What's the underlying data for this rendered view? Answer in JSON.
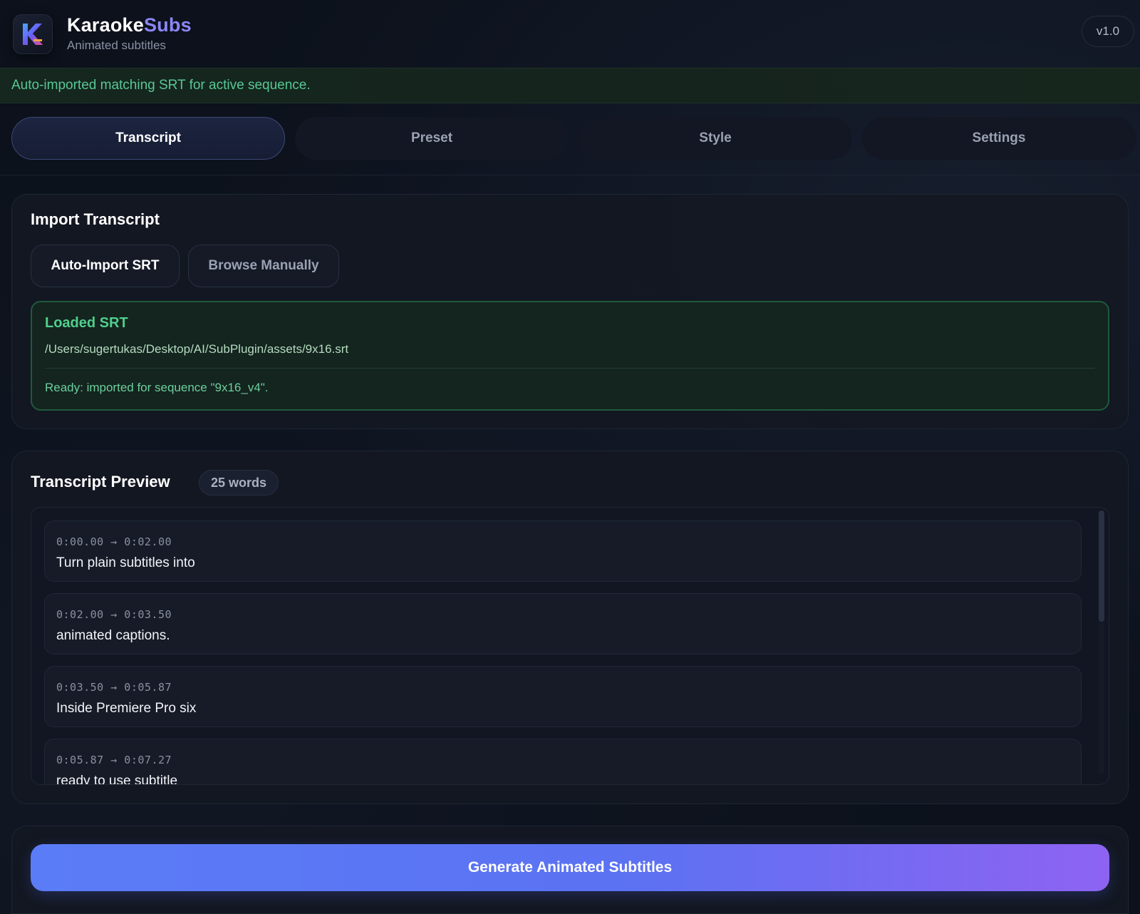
{
  "app": {
    "title_main": "Karaoke",
    "title_accent": "Subs",
    "subtitle": "Animated subtitles",
    "version": "v1.0",
    "logo_letter": "K",
    "colors": {
      "accent": "#8b86f6",
      "success": "#4fd08c",
      "background": "#0c111b"
    }
  },
  "banner": {
    "text": "Auto-imported matching SRT for active sequence."
  },
  "tabs": [
    {
      "label": "Transcript",
      "active": true
    },
    {
      "label": "Preset",
      "active": false
    },
    {
      "label": "Style",
      "active": false
    },
    {
      "label": "Settings",
      "active": false
    }
  ],
  "import_panel": {
    "title": "Import Transcript",
    "auto_import_label": "Auto-Import SRT",
    "browse_label": "Browse Manually",
    "loaded": {
      "title": "Loaded SRT",
      "path": "/Users/sugertukas/Desktop/AI/SubPlugin/assets/9x16.srt",
      "status": "Ready: imported for sequence \"9x16_v4\"."
    }
  },
  "preview_panel": {
    "title": "Transcript Preview",
    "word_count": "25 words",
    "segments": [
      {
        "time": "0:00.00 → 0:02.00",
        "text": "Turn plain subtitles into"
      },
      {
        "time": "0:02.00 → 0:03.50",
        "text": "animated captions."
      },
      {
        "time": "0:03.50 → 0:05.87",
        "text": "Inside Premiere Pro six"
      },
      {
        "time": "0:05.87 → 0:07.27",
        "text": "ready to use subtitle"
      }
    ]
  },
  "generate": {
    "label": "Generate Animated Subtitles"
  }
}
